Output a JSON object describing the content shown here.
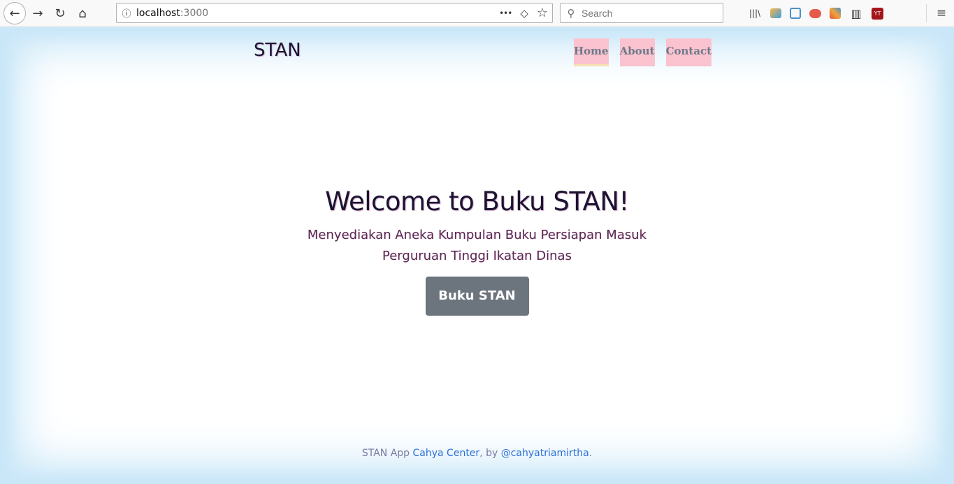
{
  "browser": {
    "url_host": "localhost",
    "url_port": ":3000",
    "search_placeholder": "Search",
    "icons": {
      "back": "←",
      "forward": "→",
      "reload": "↻",
      "home": "⌂",
      "info": "ⓘ",
      "more": "•••",
      "pocket": "◇",
      "bookmark": "☆",
      "search": "⚲",
      "library": "|||\\",
      "sidebar": "▥",
      "menu": "≡"
    },
    "extensions": [
      "ext-1",
      "ext-2",
      "ext-3",
      "ext-4",
      "ext-5"
    ]
  },
  "site": {
    "brand": "STAN",
    "nav": [
      {
        "label": "Home"
      },
      {
        "label": "About"
      },
      {
        "label": "Contact"
      }
    ],
    "hero": {
      "title": "Welcome to Buku STAN!",
      "subtitle": "Menyediakan Aneka Kumpulan Buku Persiapan Masuk Perguruan Tinggi Ikatan Dinas",
      "button": "Buku STAN"
    },
    "footer": {
      "prefix": "STAN App ",
      "link1": "Cahya Center",
      "middle": ", by ",
      "link2": "@cahyatriamirtha",
      "suffix": "."
    }
  },
  "colors": {
    "nav_bg": "#fbc2cf",
    "nav_text": "#6c7a89",
    "button_bg": "#6c757d",
    "viewport_glow": "#c9e7f8",
    "link": "#2b6fd6"
  }
}
